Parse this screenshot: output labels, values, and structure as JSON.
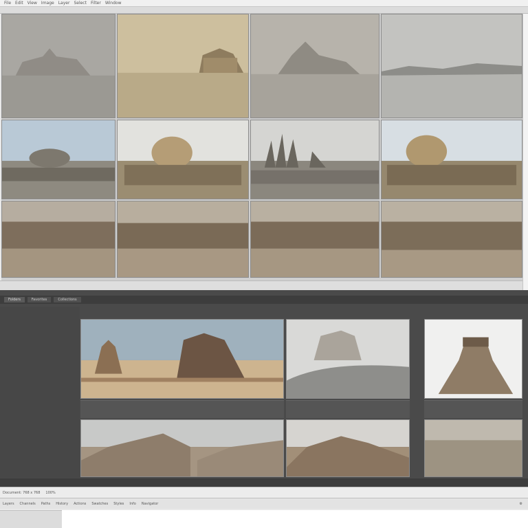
{
  "menubar": {
    "items": [
      "File",
      "Edit",
      "View",
      "Image",
      "Layer",
      "Select",
      "Filter",
      "Window"
    ]
  },
  "top_grid": {
    "rows": [
      [
        "foggy-harbor-1",
        "sepia-harbor-palace",
        "misty-lake-palace",
        "misty-lake-town"
      ],
      [
        "domed-palace-sky",
        "domed-palace-sepia",
        "gothic-cathedral",
        "domed-palace-flag"
      ],
      [
        "street-market-1",
        "street-market-2",
        "street-market-3",
        "street-market-4"
      ]
    ]
  },
  "bottom_panel": {
    "tab_labels": [
      "Folders",
      "Favorites",
      "Collections"
    ],
    "thumbnails": [
      "castle-desert",
      "misty-fortress-wave",
      "rock-tower",
      "canyon-wall-pair",
      "cliff-ruins",
      "rocky-field"
    ]
  },
  "statusbar": {
    "items": [
      "Document: 768 x 768",
      "100%",
      "Layers",
      "Channels",
      "Paths",
      "History",
      "Actions",
      "Swatches",
      "Styles",
      "Info",
      "Navigator"
    ],
    "zoom_value": "100%"
  },
  "colors": {
    "dark_panel": "#4a4a4a",
    "light_chrome": "#e9e9e9"
  }
}
